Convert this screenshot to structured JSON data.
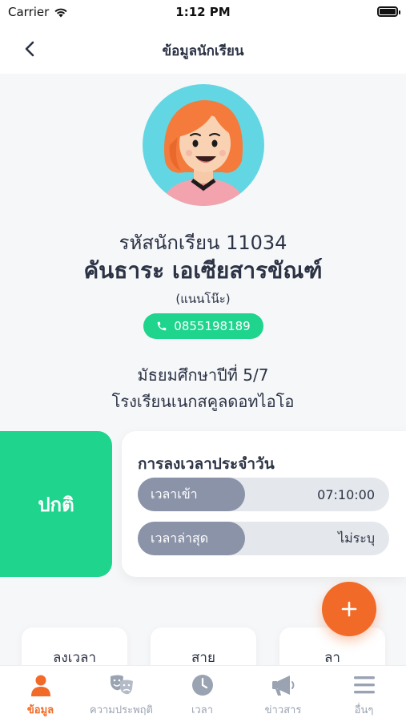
{
  "status_bar": {
    "carrier": "Carrier",
    "time": "1:12 PM"
  },
  "nav": {
    "title": "ข้อมูลนักเรียน",
    "back_icon": "chevron-left-icon"
  },
  "student": {
    "code_line": "รหัสนักเรียน 11034",
    "name": "คันธาระ เอเซียสารขัณฑ์",
    "nickname": "(แนนโน๊ะ)",
    "phone": "0855198189",
    "grade": "มัธยมศึกษาปีที่ 5/7",
    "school": "โรงเรียนเนกสคูลดอทไอโอ"
  },
  "status": {
    "label": "ปกติ",
    "color": "#1fd48d"
  },
  "attendance": {
    "title": "การลงเวลาประจำวัน",
    "rows": [
      {
        "label": "เวลาเข้า",
        "value": "07:10:00"
      },
      {
        "label": "เวลาล่าสุด",
        "value": "ไม่ระบุ"
      }
    ]
  },
  "fab": {
    "label": "+",
    "color": "#f26a27"
  },
  "actions": [
    {
      "label": "ลงเวลา"
    },
    {
      "label": "สาย"
    },
    {
      "label": "ลา"
    }
  ],
  "tabs": [
    {
      "label": "ข้อมูล",
      "icon": "person-icon",
      "active": true
    },
    {
      "label": "ความประพฤติ",
      "icon": "theater-masks-icon",
      "active": false
    },
    {
      "label": "เวลา",
      "icon": "clock-icon",
      "active": false
    },
    {
      "label": "ข่าวสาร",
      "icon": "megaphone-icon",
      "active": false
    },
    {
      "label": "อื่นๆ",
      "icon": "menu-icon",
      "active": false
    }
  ],
  "colors": {
    "accent": "#f26a27",
    "success": "#1fd48d",
    "text": "#2c3345"
  }
}
